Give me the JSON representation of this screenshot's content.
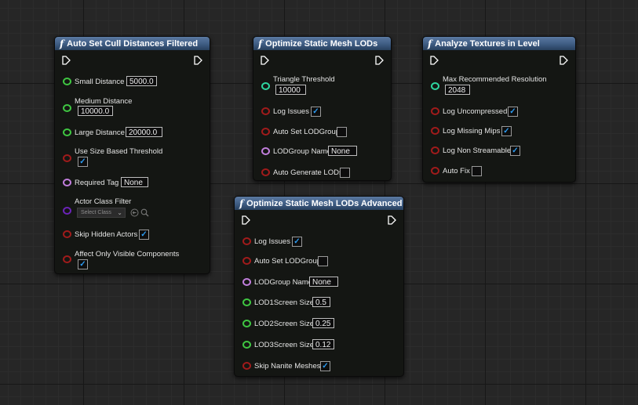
{
  "colors": {
    "float_pin": "#3fc642",
    "bool_pin": "#a01b1b",
    "string_pin": "#c17edc",
    "int_pin": "#2ed6a0",
    "class_pin": "#6b23b8",
    "checkbox_check": "#2c9cf2",
    "header": "#3e5c83"
  },
  "node_cull": {
    "title": "Auto Set Cull Distances Filtered",
    "small_distance": {
      "label": "Small Distance",
      "value": "5000.0"
    },
    "medium_distance": {
      "label": "Medium Distance",
      "value": "10000.0"
    },
    "large_distance": {
      "label": "Large Distance",
      "value": "20000.0"
    },
    "size_threshold": {
      "label": "Use Size Based Threshold",
      "checked": true
    },
    "required_tag": {
      "label": "Required Tag",
      "value": "None"
    },
    "actor_class": {
      "label": "Actor Class Filter",
      "select": "Select Class"
    },
    "skip_hidden": {
      "label": "Skip Hidden Actors",
      "checked": true
    },
    "visible_only": {
      "label": "Affect Only Visible Components",
      "checked": true
    }
  },
  "node_lods": {
    "title": "Optimize Static Mesh LODs",
    "triangle_threshold": {
      "label": "Triangle Threshold",
      "value": "10000"
    },
    "log_issues": {
      "label": "Log Issues",
      "checked": true
    },
    "auto_lodgroup": {
      "label": "Auto Set LODGroup",
      "checked": false
    },
    "lodgroup_name": {
      "label": "LODGroup Name",
      "value": "None"
    },
    "auto_generate": {
      "label": "Auto Generate LODs",
      "checked": false
    }
  },
  "node_textures": {
    "title": "Analyze Textures in Level",
    "max_resolution": {
      "label": "Max Recommended Resolution",
      "value": "2048"
    },
    "log_uncompressed": {
      "label": "Log Uncompressed",
      "checked": true
    },
    "log_missing_mips": {
      "label": "Log Missing Mips",
      "checked": true
    },
    "log_non_streamable": {
      "label": "Log Non Streamable",
      "checked": true
    },
    "auto_fix": {
      "label": "Auto Fix",
      "checked": false
    }
  },
  "node_lods_adv": {
    "title": "Optimize Static Mesh LODs Advanced",
    "log_issues": {
      "label": "Log Issues",
      "checked": true
    },
    "auto_lodgroup": {
      "label": "Auto Set LODGroup",
      "checked": false
    },
    "lodgroup_name": {
      "label": "LODGroup Name",
      "value": "None"
    },
    "lod1": {
      "label": "LOD1Screen Size",
      "value": "0.5"
    },
    "lod2": {
      "label": "LOD2Screen Size",
      "value": "0.25"
    },
    "lod3": {
      "label": "LOD3Screen Size",
      "value": "0.12"
    },
    "skip_nanite": {
      "label": "Skip Nanite Meshes",
      "checked": true
    }
  }
}
